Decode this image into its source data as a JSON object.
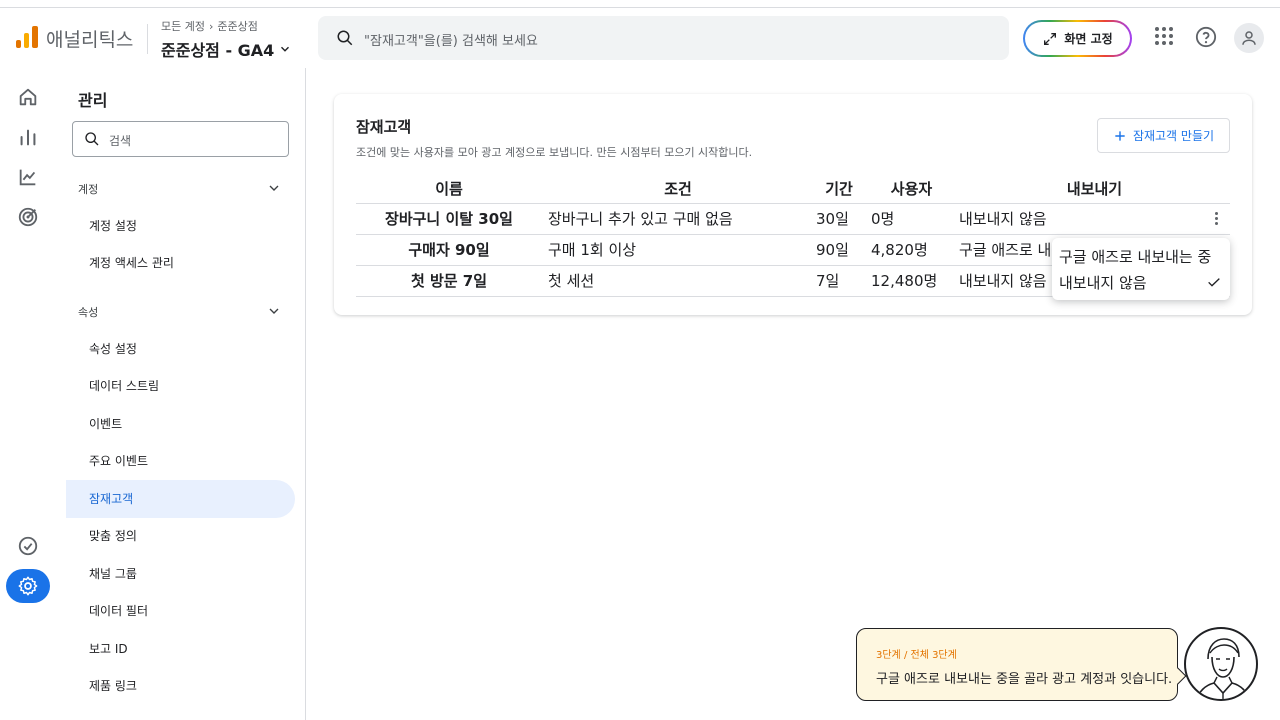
{
  "header": {
    "app_name": "애널리틱스",
    "breadcrumb": [
      "모든 계정",
      "준준상점"
    ],
    "property": "준준상점 - GA4",
    "search_placeholder": "\"잠재고객\"을(를) 검색해 보세요",
    "pin_label": "화면 고정"
  },
  "sidenav": {
    "title": "관리",
    "search_placeholder": "검색",
    "account_section": "계정",
    "account_items": [
      "계정 설정",
      "계정 액세스 관리"
    ],
    "property_section": "속성",
    "property_items": [
      "속성 설정",
      "데이터 스트림",
      "이벤트",
      "주요 이벤트",
      "잠재고객",
      "맞춤 정의",
      "채널 그룹",
      "데이터 필터",
      "보고 ID",
      "제품 링크"
    ],
    "active_item": "잠재고객"
  },
  "main": {
    "title": "잠재고객",
    "subtitle": "조건에 맞는 사용자를 모아 광고 계정으로 보냅니다. 만든 시점부터 모으기 시작합니다.",
    "create_label": "잠재고객 만들기",
    "columns": [
      "이름",
      "조건",
      "기간",
      "사용자",
      "내보내기"
    ],
    "rows": [
      {
        "name": "장바구니 이탈 30일",
        "condition": "장바구니 추가 있고 구매 없음",
        "period": "30일",
        "users": "0명",
        "export": "내보내지 않음"
      },
      {
        "name": "구매자 90일",
        "condition": "구매 1회 이상",
        "period": "90일",
        "users": "4,820명",
        "export": "구글 애즈로 내보내는 중"
      },
      {
        "name": "첫 방문 7일",
        "condition": "첫 세션",
        "period": "7일",
        "users": "12,480명",
        "export": "내보내지 않음"
      }
    ]
  },
  "dropdown": {
    "options": [
      "구글 애즈로 내보내는 중",
      "내보내지 않음"
    ],
    "selected": "내보내지 않음"
  },
  "guide": {
    "step": "3단계 / 전체 3단계",
    "text": "구글 애즈로 내보내는 중을 골라 광고 계정과 잇습니다."
  },
  "colors": {
    "accent": "#1a73e8",
    "active_bg": "#e8f0fe",
    "logo_orange": "#e37400",
    "logo_yellow": "#f9ab00",
    "guide_bg": "#fef7e0"
  }
}
